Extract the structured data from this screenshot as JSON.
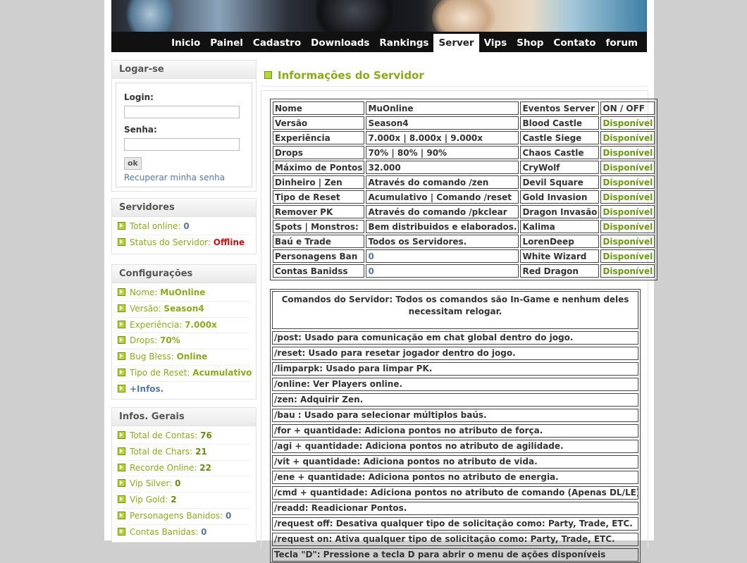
{
  "nav": {
    "items": [
      "Inicio",
      "Painel",
      "Cadastro",
      "Downloads",
      "Rankings",
      "Server",
      "Vips",
      "Shop",
      "Contato",
      "forum"
    ],
    "active": "Server"
  },
  "login": {
    "title": "Logar-se",
    "login_label": "Login:",
    "password_label": "Senha:",
    "login_value": "",
    "password_value": "",
    "ok_label": "ok",
    "recover_link": "Recuperar minha senha"
  },
  "servers": {
    "title": "Servidores",
    "total_online_label": "Total online:",
    "total_online_value": "0",
    "status_label": "Status do Servidor:",
    "status_value": "Offline"
  },
  "config": {
    "title": "Configurações",
    "items": [
      {
        "label": "Nome:",
        "value": "MuOnline"
      },
      {
        "label": "Versão:",
        "value": "Season4"
      },
      {
        "label": "Experiência:",
        "value": "7.000x"
      },
      {
        "label": "Drops:",
        "value": "70%"
      },
      {
        "label": "Bug Bless:",
        "value": "Online"
      },
      {
        "label": "Tipo de Reset:",
        "value": "Acumulativo"
      }
    ],
    "more_link": "+Infos."
  },
  "general": {
    "title": "Infos. Gerais",
    "items": [
      {
        "label": "Total de Contas:",
        "value": "76"
      },
      {
        "label": "Total de Chars:",
        "value": "21"
      },
      {
        "label": "Recorde Online:",
        "value": "22"
      },
      {
        "label": "Vip Silver:",
        "value": "0"
      },
      {
        "label": "Vip Gold:",
        "value": "2"
      },
      {
        "label": "Personagens Banidos:",
        "value": "0"
      },
      {
        "label": "Contas Banidas:",
        "value": "0"
      }
    ]
  },
  "content": {
    "title": "Informações do Servidor",
    "info_rows": [
      [
        "Nome",
        "MuOnline",
        "Eventos Server",
        "ON / OFF"
      ],
      [
        "Versão",
        "Season4",
        "Blood Castle",
        "Disponível"
      ],
      [
        "Experiência",
        "7.000x | 8.000x | 9.000x",
        "Castle Siege",
        "Disponível"
      ],
      [
        "Drops",
        "70% | 80% | 90%",
        "Chaos Castle",
        "Disponível"
      ],
      [
        "Máximo de Pontos",
        "32.000",
        "CryWolf",
        "Disponível"
      ],
      [
        "Dinheiro | Zen",
        "Através do comando /zen",
        "Devil Square",
        "Disponível"
      ],
      [
        "Tipo de Reset",
        "Acumulativo | Comando /reset",
        "Gold Invasion",
        "Disponível"
      ],
      [
        "Remover PK",
        "Através do comando /pkclear",
        "Dragon Invasão",
        "Disponível"
      ],
      [
        "Spots | Monstros:",
        "Bem distribuidos e elaborados.",
        "Kalima",
        "Disponível"
      ],
      [
        "Baú e Trade",
        "Todos os Servidores.",
        "LorenDeep",
        "Disponível"
      ],
      [
        "Personagens Ban",
        "0",
        "White Wizard",
        "Disponível"
      ],
      [
        "Contas Banidss",
        "0",
        "Red Dragon",
        "Disponível"
      ]
    ],
    "commands_header": "Comandos do Servidor: Todos os comandos são In-Game e nenhum deles necessitam relogar.",
    "commands": [
      "/post: Usado para comunicação em chat global dentro do jogo.",
      "/reset: Usado para resetar jogador dentro do jogo.",
      "/limparpk: Usado para limpar PK.",
      "/online: Ver Players online.",
      "/zen: Adquirir Zen.",
      "/bau : Usado para selecionar múltiplos baús.",
      "/for + quantidade: Adiciona pontos no atributo de força.",
      "/agi + quantidade: Adiciona pontos no atributo de agilidade.",
      "/vit + quantidade: Adiciona pontos no atributo de vida.",
      "/ene + quantidade: Adiciona pontos no atributo de energia.",
      "/cmd + quantidade: Adiciona pontos no atributo de comando (Apenas DL/LE).",
      "/readd: Readicionar Pontos.",
      "/request off: Desativa qualquer tipo de solicitação como: Party, Trade, ETC.",
      "/request on: Ativa qualquer tipo de solicitação como: Party, Trade, ETC.",
      "Tecla \"D\": Pressione a tecla D para abrir o menu de ações disponíveis"
    ]
  }
}
